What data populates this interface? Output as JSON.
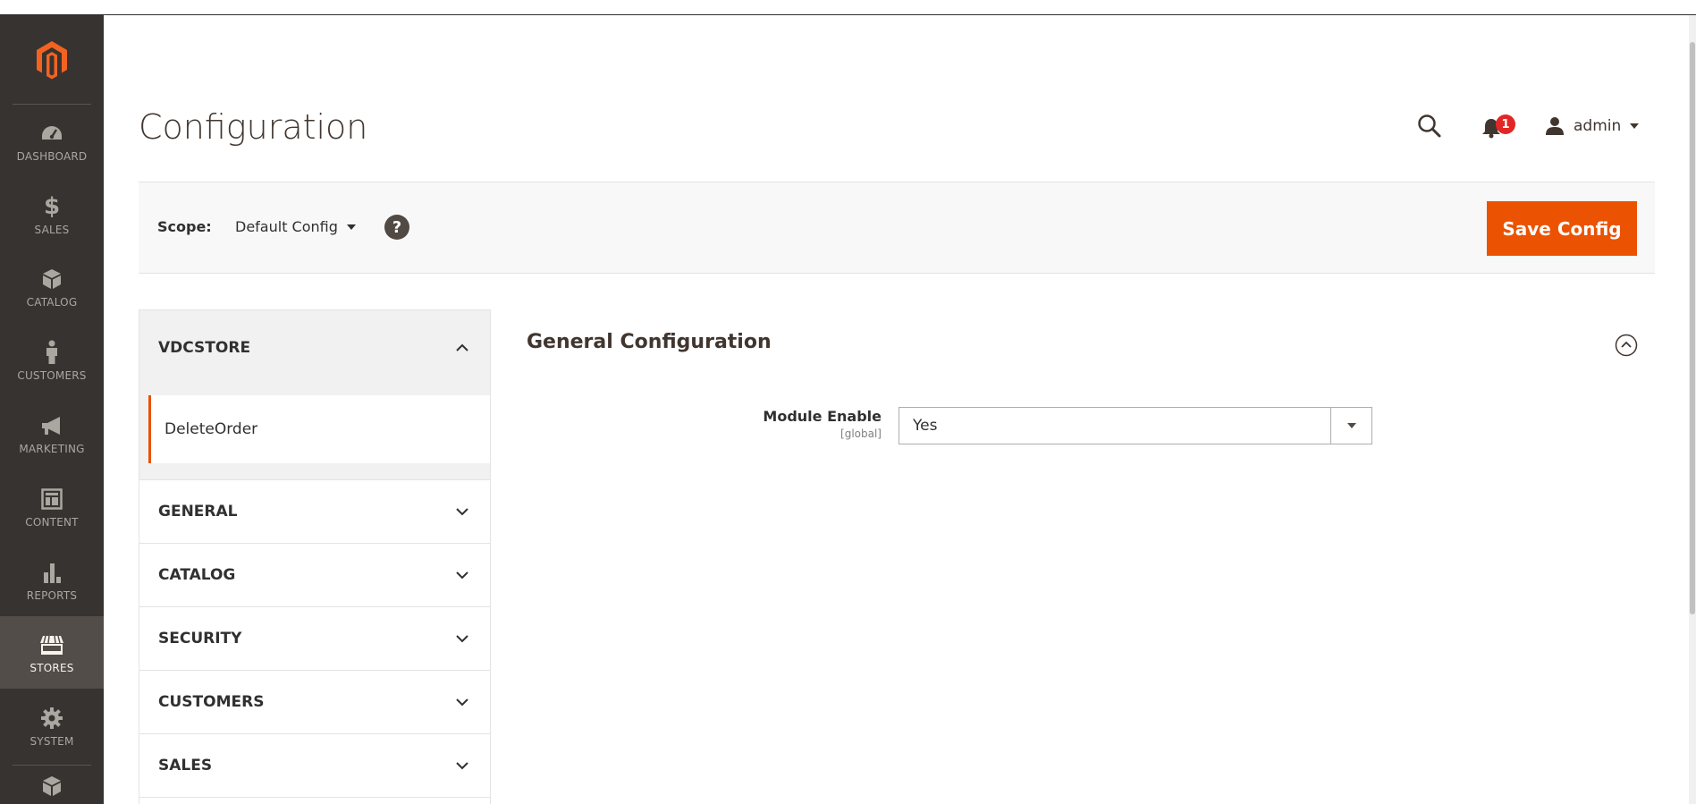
{
  "sidebar": {
    "items": [
      {
        "label": "DASHBOARD",
        "icon": "dashboard-icon"
      },
      {
        "label": "SALES",
        "icon": "dollar-icon"
      },
      {
        "label": "CATALOG",
        "icon": "box-icon"
      },
      {
        "label": "CUSTOMERS",
        "icon": "person-icon"
      },
      {
        "label": "MARKETING",
        "icon": "megaphone-icon"
      },
      {
        "label": "CONTENT",
        "icon": "layout-icon"
      },
      {
        "label": "REPORTS",
        "icon": "bar-chart-icon"
      },
      {
        "label": "STORES",
        "icon": "store-icon"
      },
      {
        "label": "SYSTEM",
        "icon": "gear-icon"
      }
    ],
    "active": "STORES"
  },
  "header": {
    "title": "Configuration",
    "notification_count": "1",
    "user_name": "admin"
  },
  "scope": {
    "label": "Scope:",
    "value": "Default Config",
    "help": "?",
    "save_label": "Save Config"
  },
  "tabs": {
    "vdcstore": "VDCSTORE",
    "vdcstore_sub": "DeleteOrder",
    "items": [
      "GENERAL",
      "CATALOG",
      "SECURITY",
      "CUSTOMERS",
      "SALES"
    ]
  },
  "section": {
    "title": "General Configuration",
    "field_label": "Module Enable",
    "field_scope": "[global]",
    "field_value": "Yes"
  },
  "colors": {
    "accent": "#eb5202",
    "sidebar_bg": "#373330",
    "badge": "#e22626"
  }
}
